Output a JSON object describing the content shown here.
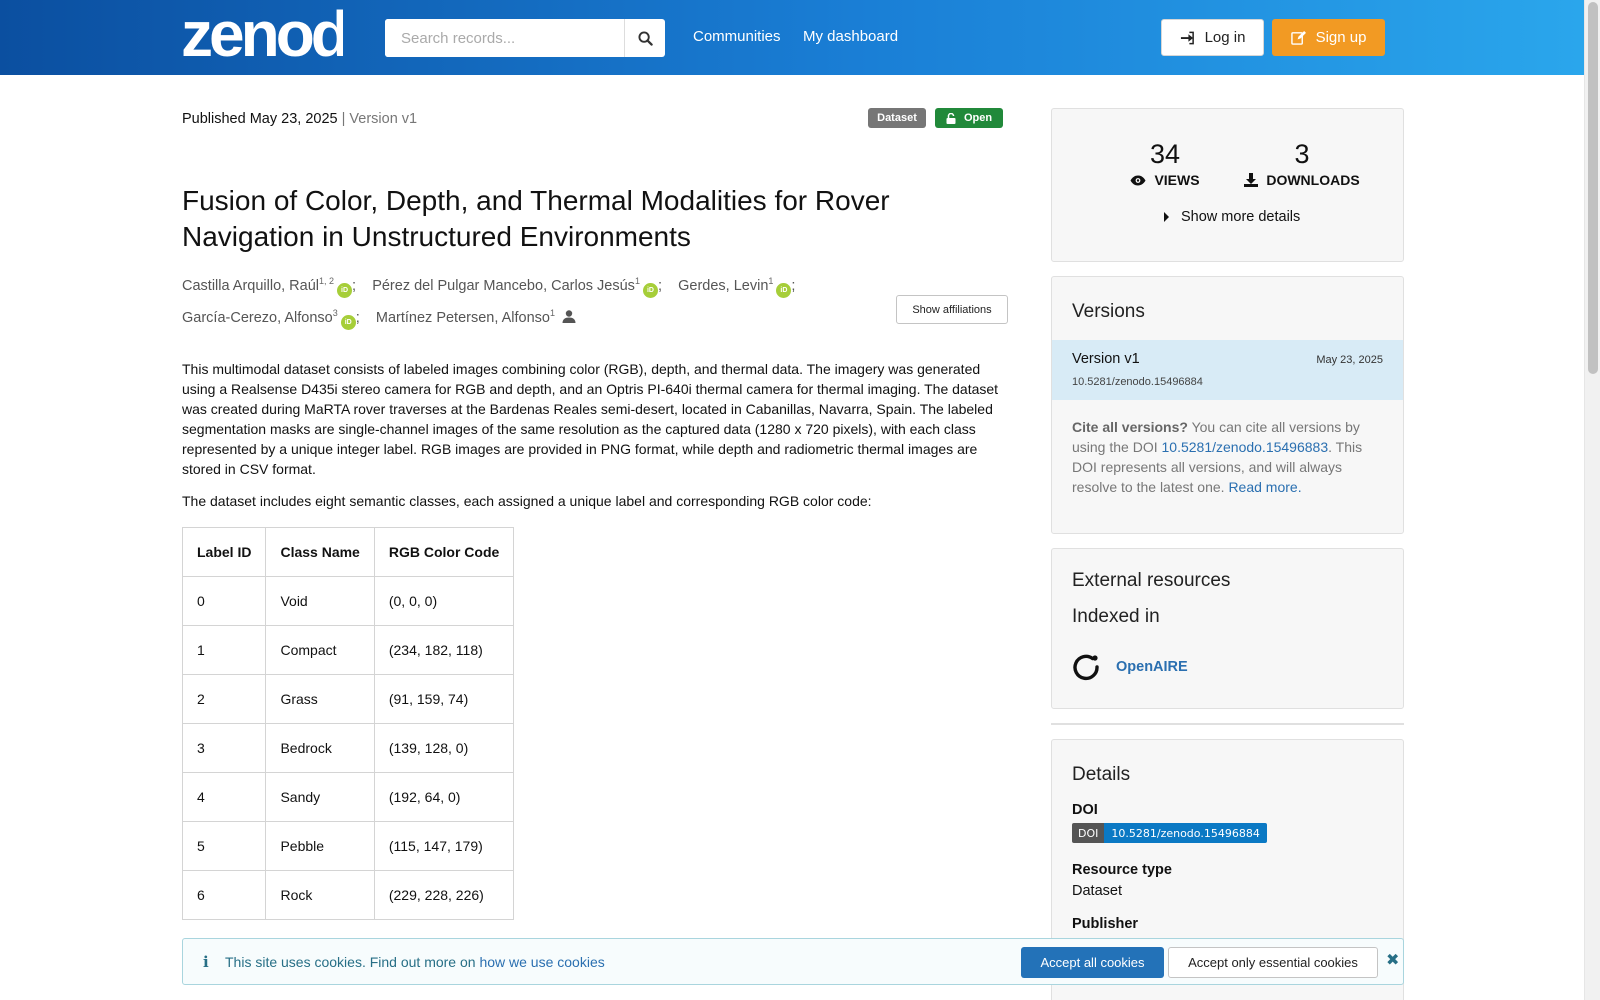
{
  "header": {
    "logo_text": "zenodo",
    "search_placeholder": "Search records...",
    "nav": [
      "Communities",
      "My dashboard"
    ],
    "login_label": "Log in",
    "signup_label": "Sign up"
  },
  "record": {
    "published": "Published May 23, 2025",
    "version": "| Version v1",
    "badge_type": "Dataset",
    "badge_access": "Open",
    "title": "Fusion of Color, Depth, and Thermal Modalities for Rover Navigation in Unstructured Environments",
    "creators": [
      {
        "name": "Castilla Arquillo, Raúl",
        "aff": "1, 2",
        "orcid": true,
        "sep": ";"
      },
      {
        "name": "Pérez del Pulgar Mancebo, Carlos Jesús",
        "aff": "1",
        "orcid": true,
        "sep": ";"
      },
      {
        "name": "Gerdes, Levin",
        "aff": "1",
        "orcid": true,
        "sep": ";"
      },
      {
        "name": "García-Cerezo, Alfonso",
        "aff": "3",
        "orcid": true,
        "sep": ";"
      },
      {
        "name": "Martínez Petersen, Alfonso",
        "aff": "1",
        "orcid": false,
        "sep": ""
      }
    ],
    "show_affiliations": "Show affiliations",
    "description": "This multimodal dataset consists of labeled images combining color (RGB), depth, and thermal data. The imagery was generated using a Realsense D435i stereo camera for RGB and depth, and an Optris PI-640i thermal camera for thermal imaging. The dataset was created during MaRTA rover traverses at the Bardenas Reales semi-desert, located in Cabanillas, Navarra, Spain. The labeled segmentation masks are single-channel images of the same resolution as the captured data (1280 x 720 pixels), with each class represented by a unique integer label. RGB images are provided in PNG format, while depth and radiometric thermal images are stored in CSV format.",
    "description2": "The dataset includes eight semantic classes, each assigned a unique label and corresponding RGB color code:",
    "table": {
      "headers": [
        "Label ID",
        "Class Name",
        "RGB Color Code"
      ],
      "rows": [
        [
          "0",
          "Void",
          "(0, 0, 0)"
        ],
        [
          "1",
          "Compact",
          "(234, 182, 118)"
        ],
        [
          "2",
          "Grass",
          "(91, 159, 74)"
        ],
        [
          "3",
          "Bedrock",
          "(139, 128, 0)"
        ],
        [
          "4",
          "Sandy",
          "(192, 64, 0)"
        ],
        [
          "5",
          "Pebble",
          "(115, 147, 179)"
        ],
        [
          "6",
          "Rock",
          "(229, 228, 226)"
        ]
      ]
    }
  },
  "stats": {
    "views": "34",
    "views_label": "VIEWS",
    "downloads": "3",
    "downloads_label": "DOWNLOADS",
    "more_details": "Show more details"
  },
  "versions": {
    "title": "Versions",
    "current": {
      "name": "Version v1",
      "date": "May 23, 2025",
      "doi": "10.5281/zenodo.15496884"
    },
    "cite_bold": "Cite all versions?",
    "cite_text1": " You can cite all versions by using the DOI ",
    "cite_doi": "10.5281/zenodo.15496883",
    "cite_text2": ". This DOI represents all versions, and will always resolve to the latest one. ",
    "read_more": "Read more."
  },
  "external": {
    "title": "External resources",
    "indexed_in": "Indexed in",
    "openaire": "OpenAIRE"
  },
  "details": {
    "title": "Details",
    "doi_label": "DOI",
    "doi_badge_left": "DOI",
    "doi_badge_right": "10.5281/zenodo.15496884",
    "resource_type_label": "Resource type",
    "resource_type": "Dataset",
    "publisher_label": "Publisher"
  },
  "cookie": {
    "text": "This site uses cookies. Find out more on ",
    "link": "how we use cookies",
    "accept_all": "Accept all cookies",
    "accept_essential": "Accept only essential cookies"
  },
  "colors": {
    "header_start": "#0b4fa0",
    "header_end": "#2aa6ec",
    "signup": "#f29a23",
    "open_badge": "#21893a",
    "link": "#2a6fb0",
    "orcid": "#a6ce39"
  }
}
